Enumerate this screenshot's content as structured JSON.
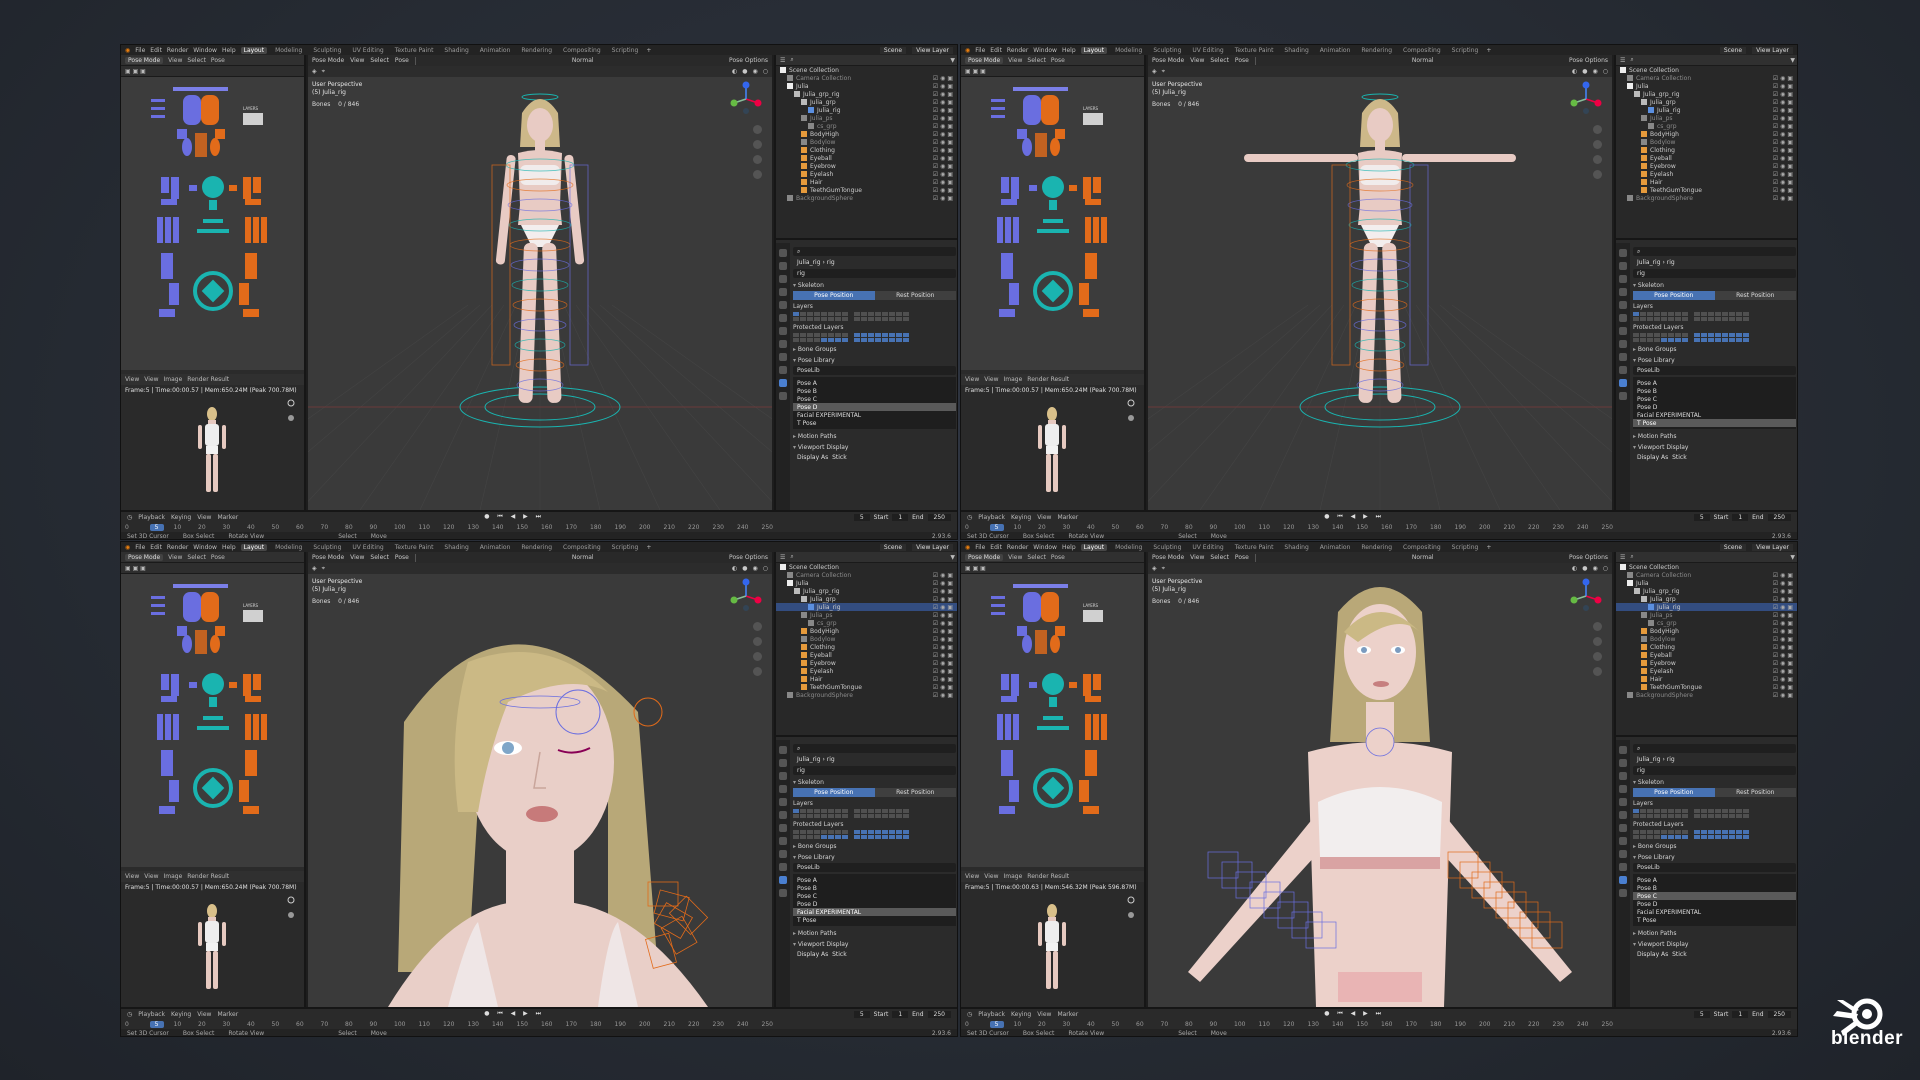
{
  "brand": {
    "logo_text": "blender",
    "accent": "#4772b3",
    "orange": "#e26b1a",
    "bone_blue": "#6a6ee0",
    "teal": "#1ab4b0"
  },
  "menu": [
    "File",
    "Edit",
    "Render",
    "Window",
    "Help"
  ],
  "workspaces": [
    "Layout",
    "Modeling",
    "Sculpting",
    "UV Editing",
    "Texture Paint",
    "Shading",
    "Animation",
    "Rendering",
    "Compositing",
    "Scripting"
  ],
  "active_workspace": "Layout",
  "scene_label": "Scene",
  "view_layer_label": "View Layer",
  "left_header": {
    "mode": "Pose Mode",
    "view": "View",
    "select": "Select",
    "pose": "Pose"
  },
  "picker": {
    "layers_label": "LAYERS"
  },
  "render_header": {
    "view": "View",
    "view2": "View",
    "image": "Image",
    "slot": "Render Result"
  },
  "viewport_header": {
    "mode": "Pose Mode",
    "view": "View",
    "select": "Select",
    "pose": "Pose",
    "orientation": "Normal",
    "options": "Pose Options"
  },
  "viewport_overlay": {
    "perspective": "User Perspective",
    "object": "(5) Julia_rig",
    "bones_label": "Bones",
    "bones_value": "0 / 846"
  },
  "outliner": {
    "rows": [
      "Scene Collection",
      "Camera Collection",
      "Julia",
      "Julia_grp_rig",
      "Julia_grp",
      "Julia_rig",
      "Julia_ps",
      "cs_grp",
      "BodyHigh",
      "Bodylow",
      "Clothing",
      "Eyeball",
      "Eyebrow",
      "Eyelash",
      "Hair",
      "TeethGumTongue",
      "BackgroundSphere"
    ]
  },
  "properties": {
    "object_name": "Julia_rig",
    "data_name": "rig",
    "data_field": "rig",
    "skeleton": "Skeleton",
    "pose_position": "Pose Position",
    "rest_position": "Rest Position",
    "layers": "Layers",
    "protected_layers": "Protected Layers",
    "bone_groups": "Bone Groups",
    "pose_library": "Pose Library",
    "poselib": "PoseLib",
    "poses": [
      "Pose A",
      "Pose B",
      "Pose C",
      "Pose D",
      "Facial EXPERIMENTAL",
      "T Pose"
    ],
    "motion_paths": "Motion Paths",
    "viewport_display": "Viewport Display",
    "display_as_label": "Display As",
    "display_as": "Stick"
  },
  "timeline": {
    "playback": "Playback",
    "keying": "Keying",
    "view": "View",
    "marker": "Marker",
    "current_frame": "5",
    "start_label": "Start",
    "start": "1",
    "end_label": "End",
    "end": "250",
    "ruler": [
      "0",
      "10",
      "20",
      "30",
      "40",
      "50",
      "60",
      "70",
      "80",
      "90",
      "100",
      "110",
      "120",
      "130",
      "140",
      "150",
      "160",
      "170",
      "180",
      "190",
      "200",
      "210",
      "220",
      "230",
      "240",
      "250"
    ]
  },
  "statusbar": {
    "cursor": "Set 3D Cursor",
    "box": "Box Select",
    "rotate": "Rotate View",
    "select": "Select",
    "move": "Move",
    "version": "2.93.6"
  },
  "screens": [
    {
      "frame_info": "Frame:5 | Time:00:00.57 | Mem:650.24M (Peak 700.78M)",
      "selected_pose": "Pose D",
      "selected_outliner": ""
    },
    {
      "frame_info": "Frame:5 | Time:00:00.57 | Mem:650.24M (Peak 700.78M)",
      "selected_pose": "T Pose",
      "selected_outliner": ""
    },
    {
      "frame_info": "Frame:5 | Time:00:00.57 | Mem:650.24M (Peak 700.78M)",
      "selected_pose": "Facial EXPERIMENTAL",
      "selected_outliner": "Julia_rig"
    },
    {
      "frame_info": "Frame:5 | Time:00:00.63 | Mem:546.32M (Peak 596.87M)",
      "selected_pose": "Pose C",
      "selected_outliner": "Julia_rig"
    }
  ]
}
